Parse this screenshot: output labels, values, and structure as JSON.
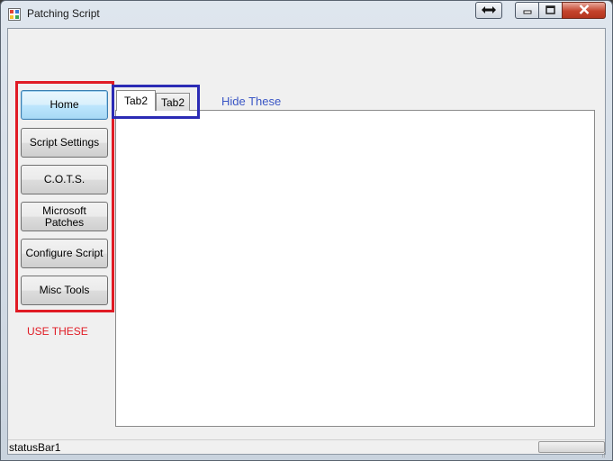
{
  "window": {
    "title": "Patching Script"
  },
  "title_buttons": {
    "swap": "swap-arrows-icon",
    "minimize": "minimize-icon",
    "maximize": "maximize-icon",
    "close": "close-icon"
  },
  "sidebar": {
    "items": [
      {
        "label": "Home"
      },
      {
        "label": "Script Settings"
      },
      {
        "label": "C.O.T.S."
      },
      {
        "label": "Microsoft Patches"
      },
      {
        "label": "Configure Script"
      },
      {
        "label": "Misc Tools"
      }
    ],
    "annotation": "USE THESE"
  },
  "tabs": {
    "items": [
      {
        "label": "Tab2"
      },
      {
        "label": "Tab2"
      }
    ],
    "annotation": "Hide These"
  },
  "statusbar": {
    "text": "statusBar1",
    "progress": 0
  },
  "colors": {
    "annotation_red": "#e01b24",
    "annotation_blue": "#2b2bb5",
    "focus_blue": "#3c7fb1"
  }
}
